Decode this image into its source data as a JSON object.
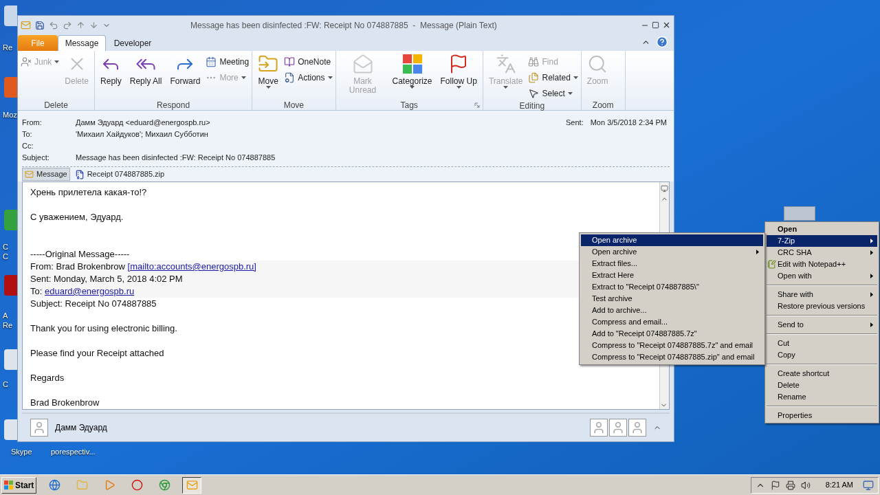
{
  "desktop_icons": [
    {
      "lines": [
        "Re"
      ]
    },
    {
      "lines": [
        "Moz"
      ]
    },
    {
      "lines": [
        "C",
        "C"
      ]
    },
    {
      "lines": [
        "A",
        "Re"
      ]
    },
    {
      "lines": [
        "C"
      ]
    },
    {
      "lines": [
        "Skype"
      ]
    },
    {
      "lines": [
        "porespectiv..."
      ]
    }
  ],
  "window": {
    "title": "Message has been disinfected :FW: Receipt No 074887885  -  Message (Plain Text)",
    "tabs": [
      {
        "label": "File",
        "kind": "file",
        "selected": false
      },
      {
        "label": "Message",
        "kind": "tab",
        "selected": true
      },
      {
        "label": "Developer",
        "kind": "tab",
        "selected": false
      }
    ],
    "ribbon": [
      {
        "label": "Delete",
        "items": [
          {
            "kind": "small",
            "label": "Junk",
            "disabled": true,
            "menu": true
          },
          {
            "kind": "large",
            "label": "Delete",
            "disabled": true,
            "menu": false
          }
        ]
      },
      {
        "label": "Respond",
        "items": [
          {
            "kind": "large",
            "label": "Reply",
            "disabled": false,
            "menu": false
          },
          {
            "kind": "large",
            "label": "Reply All",
            "disabled": false,
            "menu": false
          },
          {
            "kind": "large",
            "label": "Forward",
            "disabled": false,
            "menu": false
          },
          {
            "kind": "small",
            "label": "Meeting",
            "disabled": false,
            "menu": false
          },
          {
            "kind": "small",
            "label": "More",
            "disabled": true,
            "menu": true
          }
        ]
      },
      {
        "label": "Move",
        "items": [
          {
            "kind": "large",
            "label": "Move",
            "disabled": false,
            "menu": true
          },
          {
            "kind": "small",
            "label": "OneNote",
            "disabled": false,
            "menu": false
          },
          {
            "kind": "small",
            "label": "Actions",
            "disabled": false,
            "menu": true
          }
        ]
      },
      {
        "label": "Tags",
        "launcher": true,
        "items": [
          {
            "kind": "large",
            "label": "Mark Unread",
            "disabled": true,
            "menu": false
          },
          {
            "kind": "large",
            "label": "Categorize",
            "disabled": false,
            "menu": true
          },
          {
            "kind": "large",
            "label": "Follow Up",
            "disabled": false,
            "menu": true
          }
        ]
      },
      {
        "label": "Editing",
        "items": [
          {
            "kind": "large",
            "label": "Translate",
            "disabled": true,
            "menu": true
          },
          {
            "kind": "small",
            "label": "Find",
            "disabled": true,
            "menu": false
          },
          {
            "kind": "small",
            "label": "Related",
            "disabled": false,
            "menu": true
          },
          {
            "kind": "small",
            "label": "Select",
            "disabled": false,
            "menu": true
          }
        ]
      },
      {
        "label": "Zoom",
        "items": [
          {
            "kind": "large",
            "label": "Zoom",
            "disabled": true,
            "menu": false
          }
        ]
      }
    ],
    "header": {
      "fields": [
        {
          "label": "From:",
          "value": "Дамм Эдуард <eduard@energospb.ru>"
        },
        {
          "label": "To:",
          "value": "'Михаил Хайдуков'; Михаил Субботин"
        },
        {
          "label": "Cc:"
        },
        {
          "label": "Subject:",
          "value": "Message has been disinfected :FW: Receipt No 074887885"
        }
      ],
      "sent_label": "Sent:",
      "sent_value": "Mon 3/5/2018 2:34 PM"
    },
    "attachments": [
      {
        "label": "Message",
        "kind": "message",
        "selected": true
      },
      {
        "label": "Receipt 074887885.zip",
        "kind": "zip",
        "selected": false
      }
    ],
    "body": [
      {
        "kind": "para",
        "lines": [
          {
            "text": "Хрень прилетела какая-то!?"
          }
        ]
      },
      {
        "kind": "para",
        "lines": [
          {
            "text": "С уважением, Эдуард."
          }
        ]
      },
      {
        "kind": "quote",
        "lines": [
          {
            "text": "-----Original Message-----"
          },
          {
            "text": "From: Brad Brokenbrow ",
            "link": "[mailto:accounts@energospb.ru]"
          },
          {
            "text": "Sent: Monday, March 5, 2018 4:02 PM"
          },
          {
            "text": "To: ",
            "link": "eduard@energospb.ru"
          },
          {
            "text": "Subject: Receipt No 074887885"
          }
        ]
      },
      {
        "kind": "para",
        "lines": [
          {
            "text": "Thank you for using electronic billing."
          }
        ]
      },
      {
        "kind": "para",
        "lines": [
          {
            "text": "Please find your Receipt attached"
          }
        ]
      },
      {
        "kind": "para",
        "lines": [
          {
            "text": "Regards"
          }
        ]
      },
      {
        "kind": "para",
        "lines": [
          {
            "text": "Brad Brokenbrow"
          }
        ]
      }
    ],
    "people_pane": {
      "name": "Дамм Эдуард"
    }
  },
  "context_menu": {
    "items": [
      {
        "kind": "item",
        "label": "Open",
        "bold": true,
        "submenu": false,
        "selected": false
      },
      {
        "kind": "item",
        "label": "7-Zip",
        "bold": false,
        "submenu": true,
        "selected": true
      },
      {
        "kind": "item",
        "label": "CRC SHA",
        "bold": false,
        "submenu": true,
        "selected": false
      },
      {
        "kind": "item",
        "label": "Edit with Notepad++",
        "bold": false,
        "submenu": false,
        "selected": false,
        "icon": true
      },
      {
        "kind": "item",
        "label": "Open with",
        "bold": false,
        "submenu": true,
        "selected": false
      },
      {
        "kind": "separator"
      },
      {
        "kind": "item",
        "label": "Share with",
        "bold": false,
        "submenu": true,
        "selected": false
      },
      {
        "kind": "item",
        "label": "Restore previous versions",
        "bold": false,
        "submenu": false,
        "selected": false
      },
      {
        "kind": "separator"
      },
      {
        "kind": "item",
        "label": "Send to",
        "bold": false,
        "submenu": true,
        "selected": false
      },
      {
        "kind": "separator"
      },
      {
        "kind": "item",
        "label": "Cut",
        "bold": false,
        "submenu": false,
        "selected": false
      },
      {
        "kind": "item",
        "label": "Copy",
        "bold": false,
        "submenu": false,
        "selected": false
      },
      {
        "kind": "separator"
      },
      {
        "kind": "item",
        "label": "Create shortcut",
        "bold": false,
        "submenu": false,
        "selected": false
      },
      {
        "kind": "item",
        "label": "Delete",
        "bold": false,
        "submenu": false,
        "selected": false
      },
      {
        "kind": "item",
        "label": "Rename",
        "bold": false,
        "submenu": false,
        "selected": false
      },
      {
        "kind": "separator"
      },
      {
        "kind": "item",
        "label": "Properties",
        "bold": false,
        "submenu": false,
        "selected": false
      }
    ]
  },
  "submenu": {
    "items": [
      {
        "label": "Open archive",
        "submenu": false,
        "selected": true
      },
      {
        "label": "Open archive",
        "submenu": true,
        "selected": false
      },
      {
        "label": "Extract files...",
        "submenu": false,
        "selected": false
      },
      {
        "label": "Extract Here",
        "submenu": false,
        "selected": false
      },
      {
        "label": "Extract to \"Receipt 074887885\\\"",
        "submenu": false,
        "selected": false
      },
      {
        "label": "Test archive",
        "submenu": false,
        "selected": false
      },
      {
        "label": "Add to archive...",
        "submenu": false,
        "selected": false
      },
      {
        "label": "Compress and email...",
        "submenu": false,
        "selected": false
      },
      {
        "label": "Add to \"Receipt 074887885.7z\"",
        "submenu": false,
        "selected": false
      },
      {
        "label": "Compress to \"Receipt 074887885.7z\" and email",
        "submenu": false,
        "selected": false
      },
      {
        "label": "Compress to \"Receipt 074887885.zip\" and email",
        "submenu": false,
        "selected": false
      }
    ]
  },
  "taskbar": {
    "start": "Start",
    "apps": [
      {
        "selected": false
      },
      {
        "selected": false
      },
      {
        "selected": false
      },
      {
        "selected": false
      },
      {
        "selected": false
      },
      {
        "selected": true
      }
    ],
    "time": "8:21 AM"
  }
}
